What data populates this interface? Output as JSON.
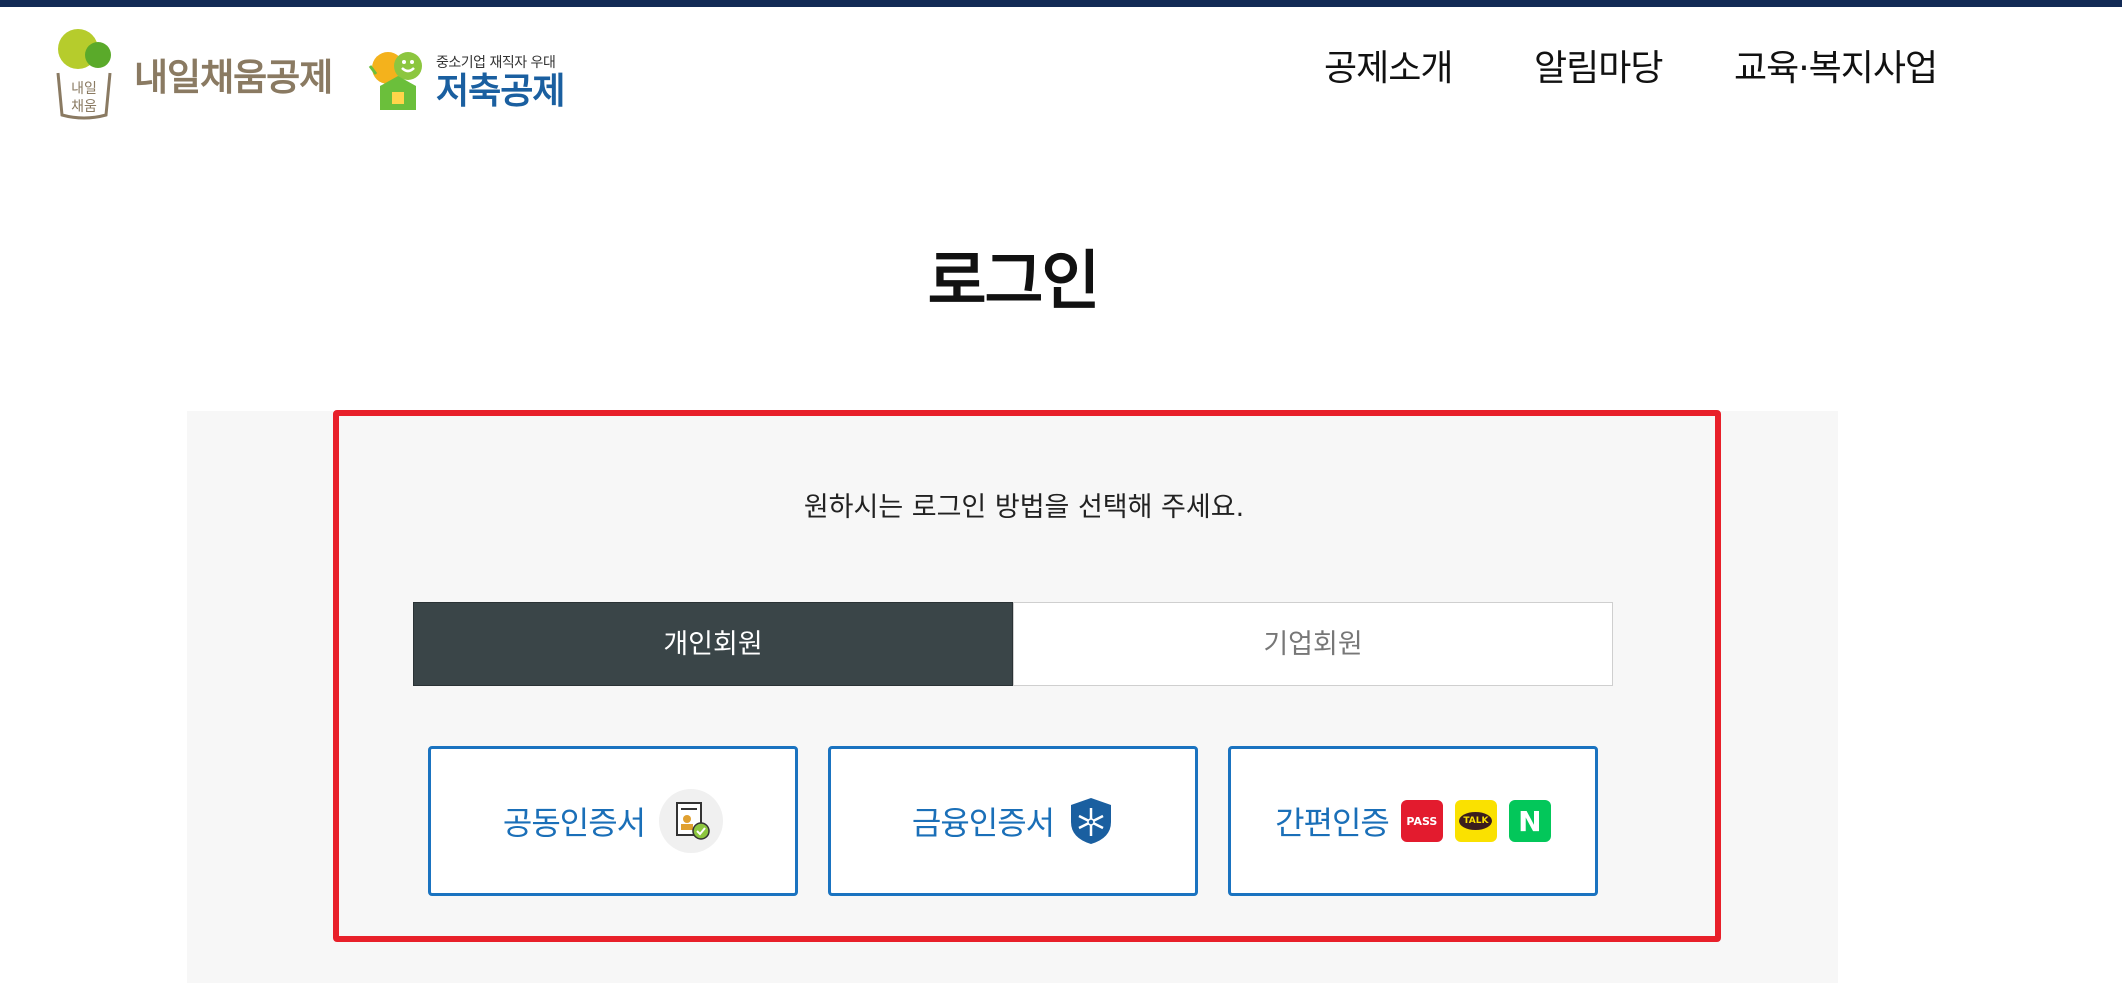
{
  "header": {
    "logo_primary": "내일채움공제",
    "logo_secondary_small": "중소기업 재직자 우대",
    "logo_secondary": "저축공제",
    "nav": [
      "공제소개",
      "알림마당",
      "교육·복지사업"
    ]
  },
  "page_title": "로그인",
  "login": {
    "instruction": "원하시는 로그인 방법을 선택해 주세요.",
    "tabs": [
      {
        "label": "개인회원",
        "active": true
      },
      {
        "label": "기업회원",
        "active": false
      }
    ],
    "methods": [
      {
        "label": "공동인증서",
        "icon": "certificate-icon"
      },
      {
        "label": "금융인증서",
        "icon": "shield-icon"
      },
      {
        "label": "간편인증",
        "icons": [
          "pass-icon",
          "kakao-talk-icon",
          "naver-icon"
        ]
      }
    ],
    "badges": {
      "pass": "PASS",
      "talk": "TALK",
      "naver": "N"
    }
  },
  "colors": {
    "top_bar": "#122a55",
    "active_tab": "#3a4548",
    "method_border": "#1a73c0",
    "highlight": "#e8202a",
    "panel_bg": "#f7f7f7"
  }
}
